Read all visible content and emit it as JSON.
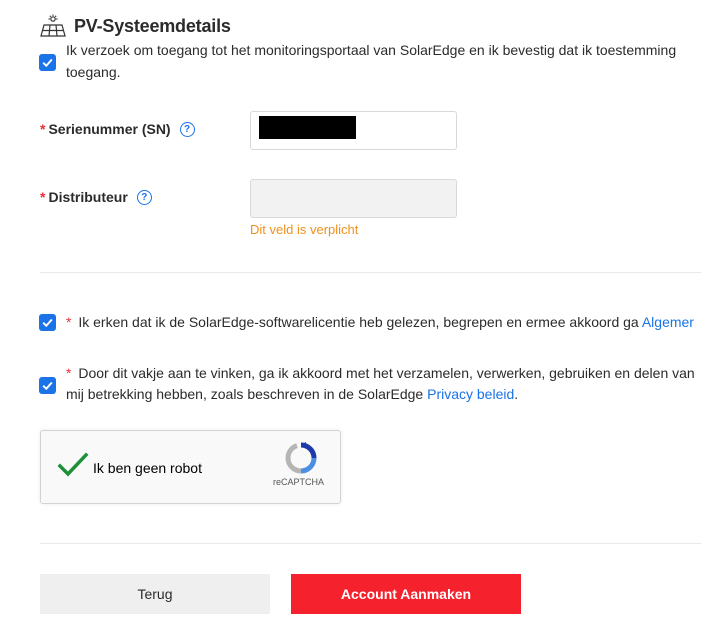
{
  "section": {
    "title": "PV-Systeemdetails",
    "icon": "solar-panel-icon"
  },
  "monitoring_consent": {
    "checked": true,
    "line1": "Ik verzoek om toegang tot het monitoringsportaal van SolarEdge en ik bevestig dat ik toestemming",
    "line2": "toegang."
  },
  "serial_number": {
    "required_mark": "*",
    "label": "Serienummer (SN)",
    "help_icon": "question-circle-icon",
    "value_redacted": true
  },
  "distributor": {
    "required_mark": "*",
    "label": "Distributeur",
    "help_icon": "question-circle-icon",
    "value": "",
    "error": "Dit veld is verplicht"
  },
  "license_consent": {
    "checked": true,
    "required_mark": "*",
    "text": "Ik erken dat ik de SolarEdge-softwarelicentie heb gelezen, begrepen en ermee akkoord ga",
    "link": "Algemer"
  },
  "data_consent": {
    "checked": true,
    "required_mark": "*",
    "line1": "Door dit vakje aan te vinken, ga ik akkoord met het verzamelen, verwerken, gebruiken en delen van",
    "line2_prefix": "mij betrekking hebben, zoals beschreven in de SolarEdge",
    "line2_link": "Privacy beleid",
    "line2_suffix": "."
  },
  "captcha": {
    "checked": true,
    "label": "Ik ben geen robot",
    "brand": "reCAPTCHA",
    "icon": "recaptcha-icon"
  },
  "buttons": {
    "back": "Terug",
    "create": "Account Aanmaken"
  },
  "colors": {
    "accent": "#1a73e8",
    "required": "#e8303a",
    "error": "#f0901a",
    "primary_button": "#f5222d",
    "secondary_button": "#efefef"
  }
}
